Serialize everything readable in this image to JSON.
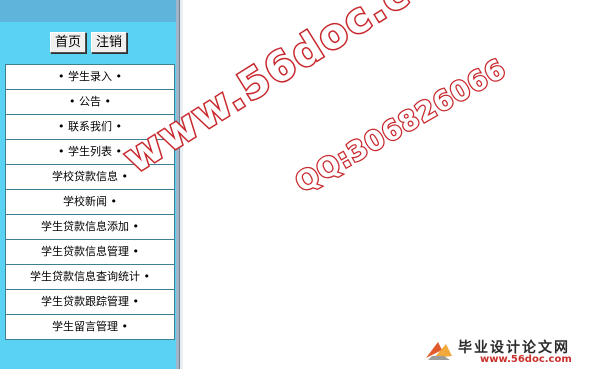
{
  "header": {
    "home_button": "首页",
    "logout_button": "注销"
  },
  "menu": {
    "items": [
      {
        "label": "• 学生录入 •"
      },
      {
        "label": "• 公告 •"
      },
      {
        "label": "• 联系我们 •"
      },
      {
        "label": "• 学生列表 •"
      },
      {
        "label": "学校贷款信息 •"
      },
      {
        "label": "学校新闻 •"
      },
      {
        "label": "学生贷款信息添加 •"
      },
      {
        "label": "学生贷款信息管理 •"
      },
      {
        "label": "学生贷款信息查询统计 •"
      },
      {
        "label": "学生贷款跟踪管理 •"
      },
      {
        "label": "学生留言管理 •"
      }
    ]
  },
  "watermark": {
    "domain": "www.56doc.com",
    "qq": "QQ:306826066"
  },
  "logo": {
    "title": "毕业设计论文网",
    "url": "www.56doc.com"
  },
  "colors": {
    "sidebar_bg": "#59d2f4",
    "sidebar_top": "#5fb4dc",
    "menu_border": "#3f7f93",
    "watermark_stroke": "#c8282d"
  }
}
